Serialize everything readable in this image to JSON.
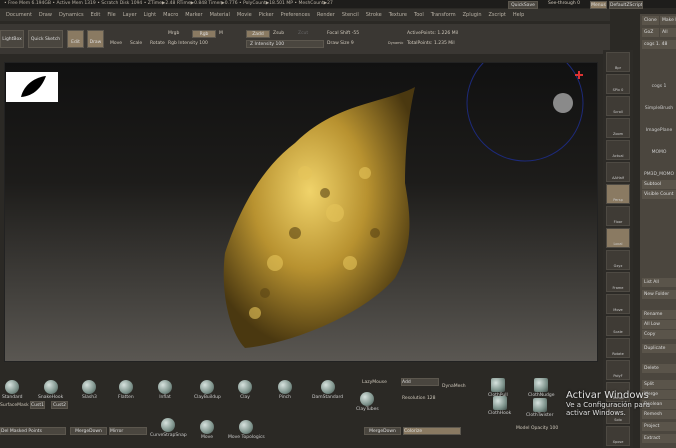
{
  "info_bar": "• Free Mem 6.194GB • Active Mem 1319 • Scratch Disk 1094 • ZTime▶2.48 RTime▶0.848 Timer▶0.776 • PolyCount▶18.501 MP • MeshCount▶27",
  "menus": [
    "Document",
    "Draw",
    "Dynamics",
    "Edit",
    "File",
    "Layer",
    "Light",
    "Macro",
    "Marker",
    "Material",
    "Movie",
    "Picker",
    "Preferences",
    "Render",
    "Stencil",
    "Stroke",
    "Texture",
    "Tool",
    "Transform",
    "Zplugin",
    "Zscript",
    "Help"
  ],
  "topright": {
    "quicksave": "QuickSave",
    "seethrough": "See-through  0",
    "menus": "Menus",
    "defaultzscript": "DefaultZScript"
  },
  "toolbar": {
    "lightbox": "LightBox",
    "quicksketch": "Quick Sketch",
    "edit": "Edit",
    "draw": "Draw",
    "move": "Move",
    "scale": "Scale",
    "rotate": "Rotate",
    "mrgb": "Mrgb",
    "rgb": "Rgb",
    "m": "M",
    "rgb_intensity": "Rgb Intensity 100",
    "zadd": "Zadd",
    "zsub": "Zsub",
    "zcut": "Zcut",
    "z_intensity": "Z Intensity 100",
    "focal_shift": "Focal Shift -55",
    "draw_size": "Draw Size 9",
    "dynamic": "Dynamic",
    "active_points": "ActivePoints: 1.226 Mil",
    "total_points": "TotalPoints: 1.235 Mil"
  },
  "right_icons": [
    "Bpr",
    "SPix 0",
    "Scroll",
    "Zoom",
    "Actual",
    "AAHalf",
    "Persp",
    "Floor",
    "Local",
    "Gxyz",
    "Frame",
    "Move",
    "Scale",
    "Rotate",
    "PolyF",
    "Transp",
    "Solo",
    "Xpose"
  ],
  "panel": {
    "items": [
      "Clone",
      "Make PolyMesh3D",
      "GoZ",
      "All",
      "Lightbox▶Tools",
      "cogs 1. 48"
    ],
    "tools": [
      "cogs 1",
      "SimpleBrush",
      "ImagePlane",
      "MOMO",
      "PM3D_MOMO"
    ],
    "subtool": "Subtool",
    "visible_count": "Visible Count",
    "buttons": [
      "List All",
      "New Folder",
      "Rename",
      "All Low",
      "Copy",
      "Duplicate",
      "Delete",
      "Split",
      "Merge",
      "Boolean",
      "Remesh",
      "Project",
      "Extract"
    ]
  },
  "brushes_row1": [
    "Standard",
    "SnakeHook",
    "Slash3",
    "Flatten",
    "Inflat",
    "ClayBuildup",
    "Clay",
    "Pinch",
    "DamStandard"
  ],
  "brushes_row2": [
    "CurveStrapSnap",
    "Move",
    "Move Topologics",
    "ClayTubes"
  ],
  "shelf": {
    "surfacemask": "SurfaceMask",
    "cust1": "Cust1",
    "cust2": "Cust2",
    "masked": "Del Masked Points",
    "mergedown": "MergeDown",
    "mirror": "Mirror",
    "lazymouse": "LazyMouse",
    "add": "Add",
    "dynamesh": "DynaMesh",
    "resolution": "Resolution 128",
    "mergedown2": "MergeDown",
    "colorize": "Colorize",
    "model_opacity": "Model Opacity 100"
  },
  "cloth": [
    "ClothPull",
    "ClothNudge",
    "ClothHook",
    "ClothTwister"
  ],
  "watermark": {
    "title": "Activar Windows",
    "sub": "Ve a Configuración para activar Windows."
  },
  "colors": {
    "accent": "#8a7a62",
    "mesh_gold": "#c9a53a"
  }
}
